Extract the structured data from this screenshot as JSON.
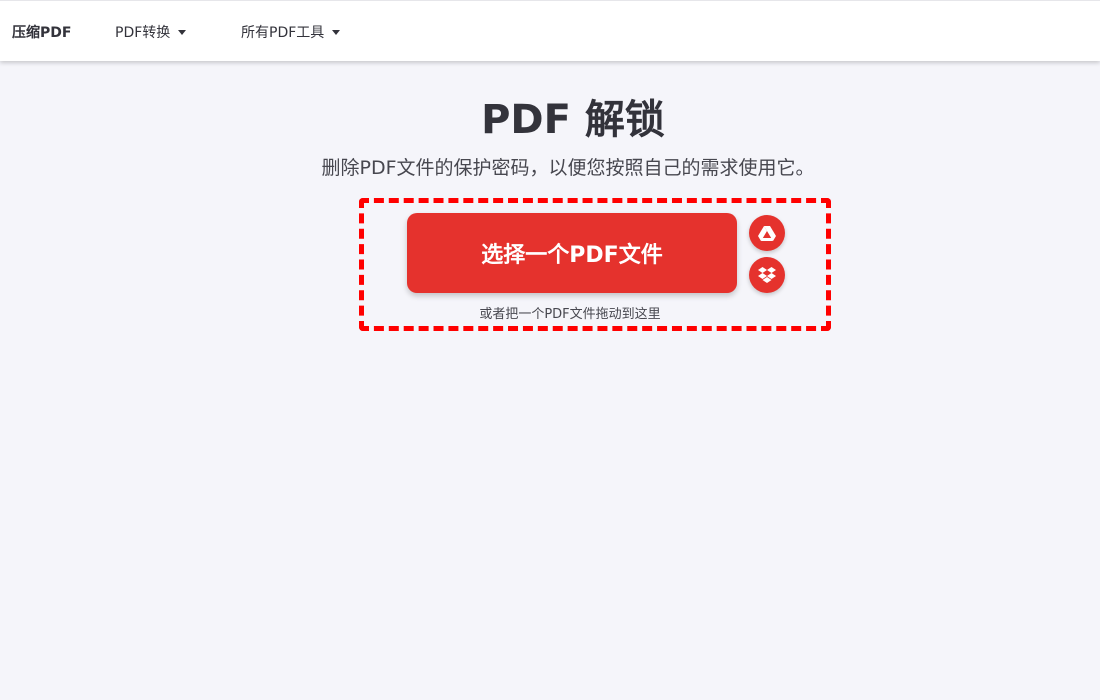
{
  "nav": {
    "brand": "压缩PDF",
    "convert": "PDF转换",
    "all_tools": "所有PDF工具"
  },
  "main": {
    "title": "PDF 解锁",
    "subtitle": "删除PDF文件的保护密码，以便您按照自己的需求使用它。",
    "select_button": "选择一个PDF文件",
    "drop_hint": "或者把一个PDF文件拖动到这里"
  },
  "icons": {
    "google_drive": "google-drive-icon",
    "dropbox": "dropbox-icon",
    "dropdown": "caret-down-icon"
  },
  "colors": {
    "accent": "#e5322d",
    "dropzone_border": "#ff0000",
    "background": "#f5f5fa",
    "text": "#33333b"
  }
}
